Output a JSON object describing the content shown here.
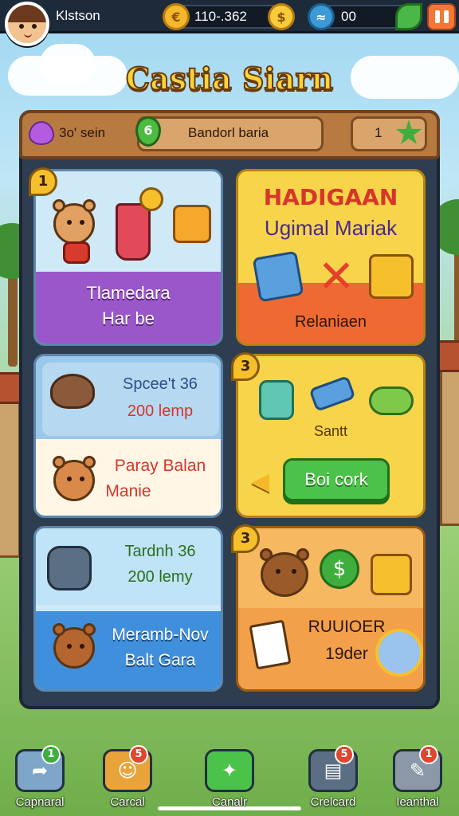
{
  "header": {
    "player_name": "Klstson",
    "currency_amount": "110-.362",
    "gem_count": "00"
  },
  "title": "Castia Siarn",
  "status_bar": {
    "left_label": "3o' sein",
    "level": "6",
    "name_field": "Bandorl baria",
    "count": "1"
  },
  "cards": {
    "card1": {
      "badge": "1",
      "line1": "Tlamedara",
      "line2": "Har be"
    },
    "card2": {
      "title": "HADIGAAN",
      "subtitle": "Ugimal Mariak",
      "footer": "Relaniaen"
    },
    "card3": {
      "line1": "Spcee't 36",
      "line2": "200 lemp",
      "line3": "Paray Balan",
      "line4": "Manie"
    },
    "card4": {
      "badge": "3",
      "label": "Santt",
      "button": "Boi cork"
    },
    "card5": {
      "line1": "Tardnh 36",
      "line2": "200 lemy",
      "line3": "Meramb-Nov",
      "line4": "Balt Gara"
    },
    "card6": {
      "badge": "3",
      "line1": "RUUIOER",
      "line2": "19der"
    }
  },
  "bottom_nav": [
    {
      "label": "Capnaral",
      "badge": "1",
      "icon": "share-icon",
      "color": "#7ea6c8",
      "badge_color": "#3fae3d"
    },
    {
      "label": "Carcal",
      "badge": "5",
      "icon": "smile-icon",
      "color": "#e8a43a",
      "badge_color": "#e0452f"
    },
    {
      "label": "Canalr",
      "badge": "",
      "icon": "cookie-icon",
      "color": "#4bc24a",
      "badge_color": ""
    },
    {
      "label": "Crelcard",
      "badge": "5",
      "icon": "ticket-icon",
      "color": "#5a6e84",
      "badge_color": "#e0452f"
    },
    {
      "label": "Ieanthal",
      "badge": "1",
      "icon": "pencil-icon",
      "color": "#8a98a8",
      "badge_color": "#e0452f"
    }
  ]
}
